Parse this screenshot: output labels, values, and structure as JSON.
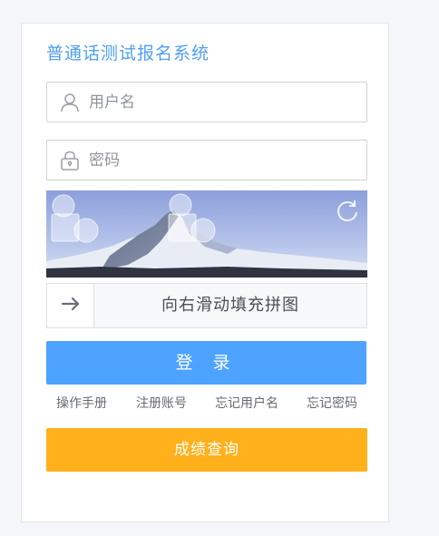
{
  "title": "普通话测试报名系统",
  "username": {
    "placeholder": "用户名",
    "icon": "user-icon"
  },
  "password": {
    "placeholder": "密码",
    "icon": "lock-icon"
  },
  "captcha": {
    "refresh_icon": "refresh-icon",
    "slider_text": "向右滑动填充拼图",
    "handle_icon": "arrow-right-icon"
  },
  "login_label": "登 录",
  "links": [
    "操作手册",
    "注册账号",
    "忘记用户名",
    "忘记密码"
  ],
  "score_label": "成绩查询",
  "colors": {
    "primary": "#4da3ff",
    "title": "#4e9ff5",
    "score": "#ffb01b"
  }
}
